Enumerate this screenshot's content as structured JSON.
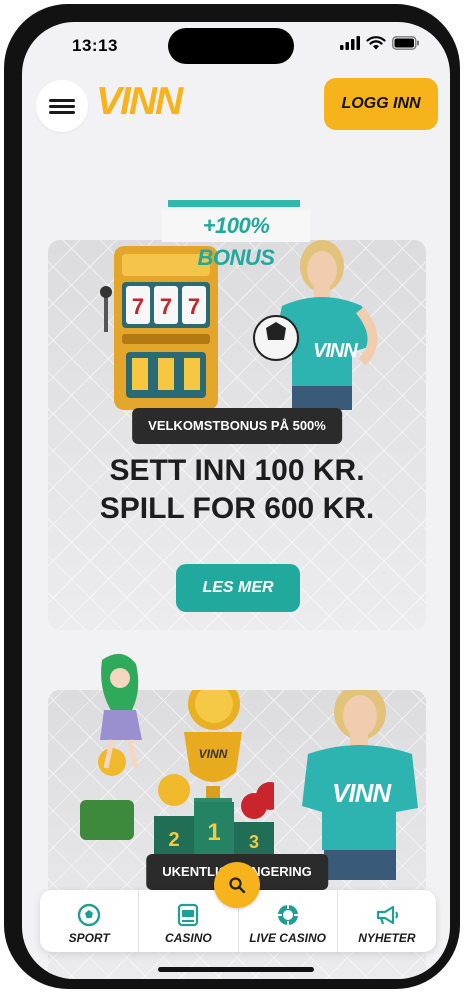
{
  "status": {
    "time": "13:13"
  },
  "header": {
    "logo": "VINN",
    "login_label": "LOGG INN"
  },
  "promo1": {
    "bonus_tag": "+100% BONUS",
    "shirt_text": "VINN",
    "badge": "VELKOMSTBONUS PÅ 500%",
    "line1": "SETT INN 100 KR.",
    "line2": "SPILL FOR 600 KR.",
    "cta": "LES MER"
  },
  "promo2": {
    "shirt_text": "VINN",
    "trophy_text": "VINN",
    "podium": [
      "2",
      "1",
      "3"
    ],
    "badge": "UKENTLIG RANGERING"
  },
  "tabbar": {
    "items": [
      {
        "label": "SPORT",
        "icon": "soccer-ball-icon"
      },
      {
        "label": "CASINO",
        "icon": "slot-machine-icon"
      },
      {
        "label": "LIVE CASINO",
        "icon": "casino-chip-icon"
      },
      {
        "label": "NYHETER",
        "icon": "megaphone-icon"
      }
    ]
  },
  "colors": {
    "accent_yellow": "#f6b31b",
    "accent_teal": "#22a99d",
    "background": "#f2f2f4"
  }
}
